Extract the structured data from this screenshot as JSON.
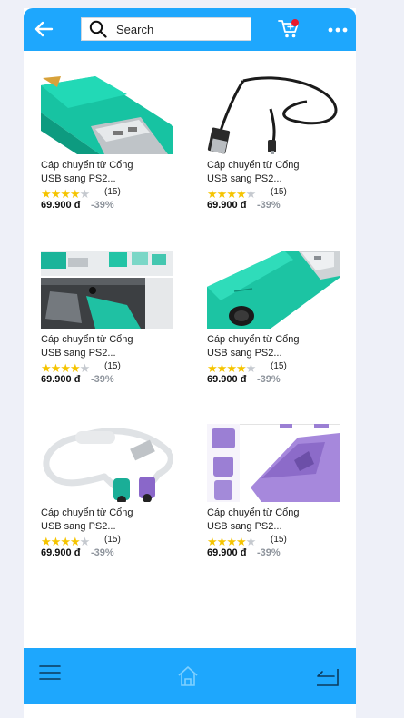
{
  "search": {
    "placeholder": "Search"
  },
  "colors": {
    "accent": "#1ea7fd",
    "star_filled": "#f5c400",
    "star_empty": "#c5c9cf",
    "cart_badge": "#e8182c"
  },
  "products": [
    {
      "name_line1": "Cáp chuyển từ Cổng",
      "name_line2": "USB sang PS2...",
      "rating": 4,
      "reviews": "(15)",
      "price": "69.900 đ",
      "discount": "-39%",
      "image": "green-usb-ps2-adapter-closeup"
    },
    {
      "name_line1": "Cáp chuyển từ Cổng",
      "name_line2": "USB sang PS2...",
      "rating": 4,
      "reviews": "(15)",
      "price": "69.900 đ",
      "discount": "-39%",
      "image": "black-usb-cable"
    },
    {
      "name_line1": "Cáp chuyển từ Cổng",
      "name_line2": "USB sang PS2...",
      "rating": 4,
      "reviews": "(15)",
      "price": "69.900 đ",
      "discount": "-39%",
      "image": "adapter-plugged-into-computer"
    },
    {
      "name_line1": "Cáp chuyển từ Cổng",
      "name_line2": "USB sang PS2...",
      "rating": 4,
      "reviews": "(15)",
      "price": "69.900 đ",
      "discount": "-39%",
      "image": "green-ps2-usb-adapter"
    },
    {
      "name_line1": "Cáp chuyển từ Cổng",
      "name_line2": "USB sang PS2...",
      "rating": 4,
      "reviews": "(15)",
      "price": "69.900 đ",
      "discount": "-39%",
      "image": "white-usb-to-dual-ps2-cable"
    },
    {
      "name_line1": "Cáp chuyển từ Cổng",
      "name_line2": "USB sang PS2...",
      "rating": 4,
      "reviews": "(15)",
      "price": "69.900 đ",
      "discount": "-39%",
      "image": "purple-ps2-adapter"
    }
  ],
  "icons": {
    "back": "back-arrow-icon",
    "search": "search-icon",
    "cart": "cart-icon",
    "more": "more-icon",
    "menu": "menu-icon",
    "home": "home-icon",
    "return": "return-icon"
  }
}
